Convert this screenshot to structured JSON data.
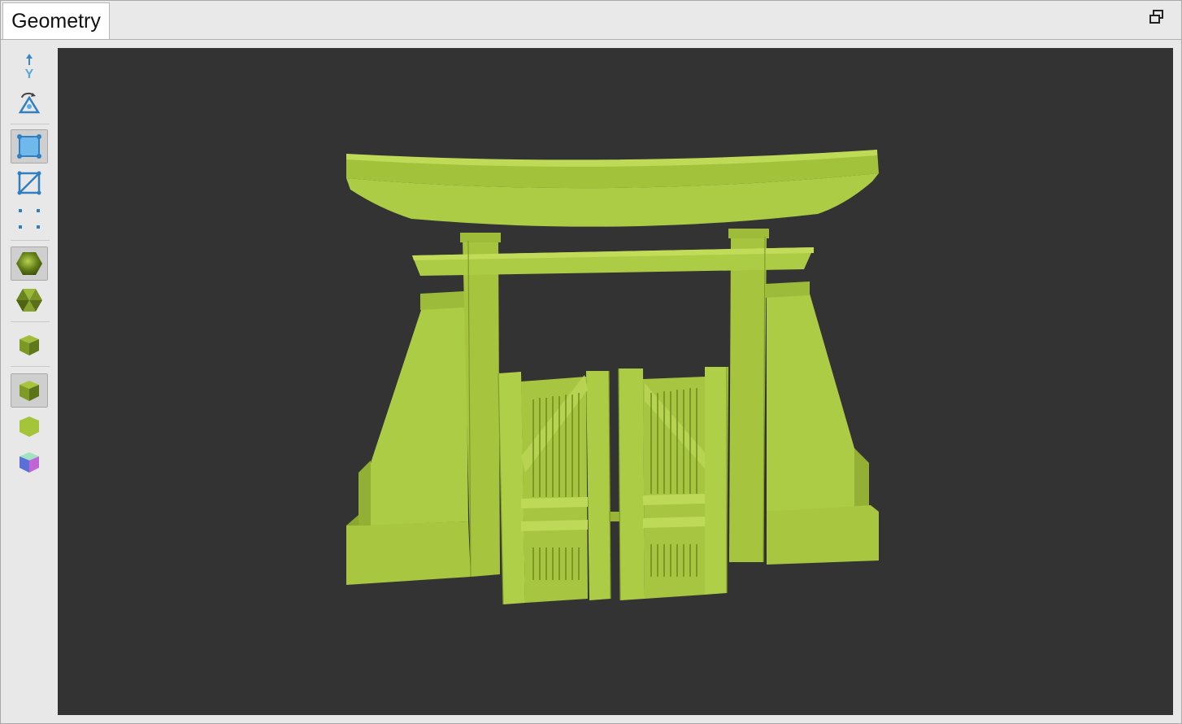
{
  "panel": {
    "tab_label": "Geometry",
    "restore_icon": "restore-window-icon"
  },
  "toolbar": {
    "items": [
      {
        "icon": "y-axis-up-icon",
        "active": false
      },
      {
        "icon": "camera-rotate-icon",
        "active": false
      },
      {
        "icon": "face-select-icon",
        "active": true
      },
      {
        "icon": "edge-select-icon",
        "active": false
      },
      {
        "icon": "vertex-select-icon",
        "active": false
      },
      {
        "icon": "smooth-shading-icon",
        "active": true
      },
      {
        "icon": "flat-shading-icon",
        "active": false
      },
      {
        "icon": "wireframe-cube-icon",
        "active": false
      },
      {
        "icon": "lit-cube-icon",
        "active": true
      },
      {
        "icon": "unlit-cube-icon",
        "active": false
      },
      {
        "icon": "normals-cube-icon",
        "active": false
      }
    ]
  },
  "viewport": {
    "background": "#333333",
    "model_color": "#adcc45",
    "model": "torii-gate-with-fence"
  }
}
